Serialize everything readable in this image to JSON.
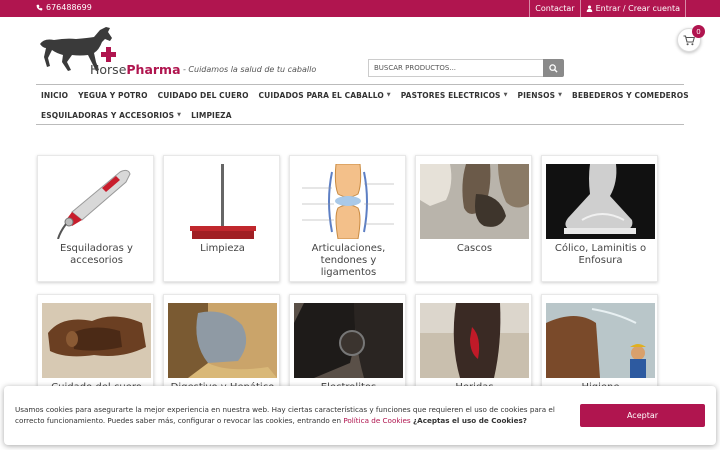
{
  "topbar": {
    "phone": "676488699",
    "contact": "Contactar",
    "login": "Entrar / Crear cuenta"
  },
  "header": {
    "logo_left": "Horse",
    "logo_right": "Pharma",
    "tagline": "- Cuidamos la salud de tu caballo",
    "search_placeholder": "BUSCAR PRODUCTOS...",
    "cart_count": "0"
  },
  "nav": {
    "row1": [
      {
        "label": "INICIO",
        "dropdown": false
      },
      {
        "label": "YEGUA Y POTRO",
        "dropdown": false
      },
      {
        "label": "CUIDADO DEL CUERO",
        "dropdown": false
      },
      {
        "label": "CUIDADOS PARA EL CABALLO",
        "dropdown": true
      },
      {
        "label": "PASTORES ELECTRICOS",
        "dropdown": true
      },
      {
        "label": "PIENSOS",
        "dropdown": true
      },
      {
        "label": "BEBEDEROS Y COMEDEROS",
        "dropdown": false
      }
    ],
    "row2": [
      {
        "label": "ESQUILADORAS Y ACCESORIOS",
        "dropdown": true
      },
      {
        "label": "LIMPIEZA",
        "dropdown": false
      }
    ]
  },
  "categories": [
    {
      "label": "Esquiladoras y accesorios"
    },
    {
      "label": "Limpieza"
    },
    {
      "label": "Articulaciones, tendones y ligamentos"
    },
    {
      "label": "Cascos"
    },
    {
      "label": "Cólico, Laminitis o Enfosura"
    },
    {
      "label": "Cuidado del cuero"
    },
    {
      "label": "Digestivo y Hepático"
    },
    {
      "label": "Electrolitos"
    },
    {
      "label": "Heridas"
    },
    {
      "label": "Higiene"
    }
  ],
  "cookie": {
    "text": "Usamos cookies para asegurarte la mejor experiencia en nuestra web.  Hay ciertas características y funciones que requieren el uso de cookies para el correcto funcionamiento. Puedes saber más, configurar o revocar las cookies, entrando en",
    "policy_link": "Política de Cookies",
    "question": "¿Aceptas el uso de Cookies?",
    "accept": "Aceptar"
  },
  "colors": {
    "brand": "#b0154f",
    "search_button": "#8a8a8a"
  }
}
